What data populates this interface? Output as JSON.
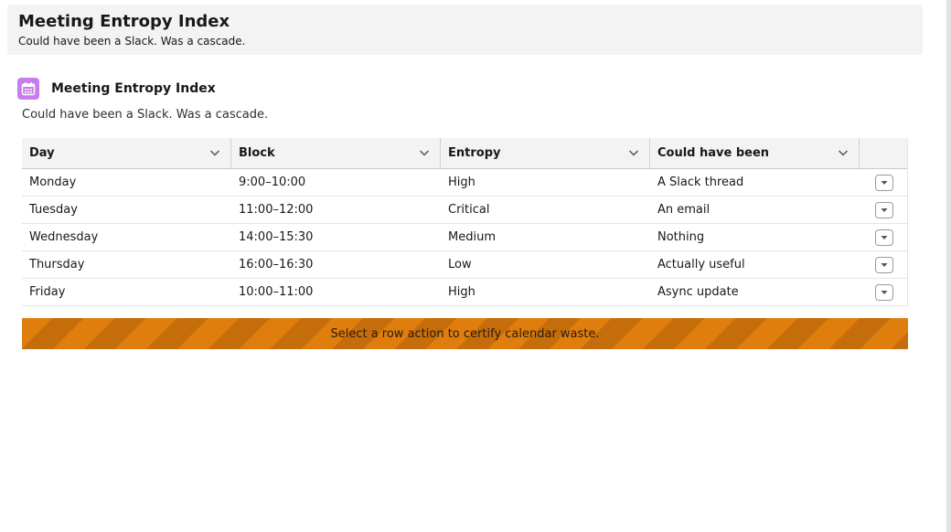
{
  "header": {
    "title": "Meeting Entropy Index",
    "subtitle": "Could have been a Slack. Was a cascade."
  },
  "card": {
    "icon": "calendar-icon",
    "title": "Meeting Entropy Index",
    "description": "Could have been a Slack. Was a cascade.",
    "accent_color": "#c77df0"
  },
  "table": {
    "columns": [
      {
        "label": "Day"
      },
      {
        "label": "Block"
      },
      {
        "label": "Entropy"
      },
      {
        "label": "Could have been"
      }
    ],
    "rows": [
      {
        "day": "Monday",
        "block": "9:00–10:00",
        "entropy": "High",
        "could_have_been": "A Slack thread"
      },
      {
        "day": "Tuesday",
        "block": "11:00–12:00",
        "entropy": "Critical",
        "could_have_been": "An email"
      },
      {
        "day": "Wednesday",
        "block": "14:00–15:30",
        "entropy": "Medium",
        "could_have_been": "Nothing"
      },
      {
        "day": "Thursday",
        "block": "16:00–16:30",
        "entropy": "Low",
        "could_have_been": "Actually useful"
      },
      {
        "day": "Friday",
        "block": "10:00–11:00",
        "entropy": "High",
        "could_have_been": "Async update"
      }
    ]
  },
  "banner": {
    "text": "Select a row action to certify calendar waste.",
    "color": "#e07e0d"
  }
}
